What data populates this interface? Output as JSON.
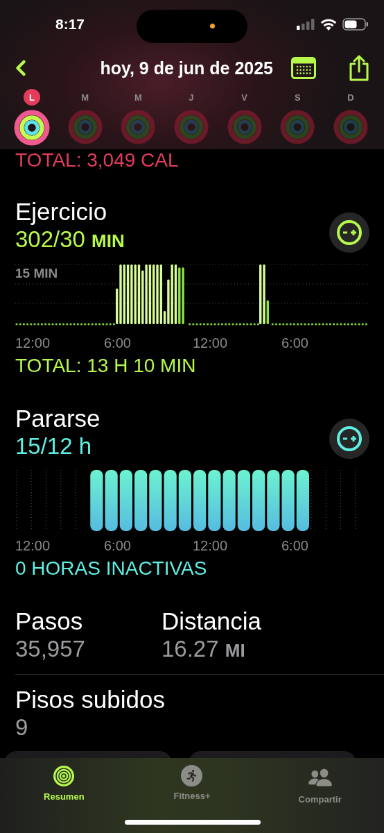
{
  "status_bar": {
    "time": "8:17"
  },
  "nav": {
    "title": "hoy, 9 de jun de 2025"
  },
  "week": [
    {
      "letter": "L",
      "selected": true
    },
    {
      "letter": "M",
      "selected": false
    },
    {
      "letter": "M",
      "selected": false
    },
    {
      "letter": "J",
      "selected": false
    },
    {
      "letter": "V",
      "selected": false
    },
    {
      "letter": "S",
      "selected": false
    },
    {
      "letter": "D",
      "selected": false
    }
  ],
  "move": {
    "total": "TOTAL: 3,049 CAL"
  },
  "exercise": {
    "title": "Ejercicio",
    "value": "302/30",
    "unit": "MIN",
    "gridline_label": "15 MIN",
    "x_labels": [
      "12:00",
      "6:00",
      "12:00",
      "6:00"
    ],
    "total": "TOTAL: 13 H 10 MIN"
  },
  "stand": {
    "title": "Pararse",
    "value": "15/12 h",
    "x_labels": [
      "12:00",
      "6:00",
      "12:00",
      "6:00"
    ],
    "total": "0 HORAS INACTIVAS"
  },
  "stats": [
    {
      "label": "Pasos",
      "value": "35,957"
    },
    {
      "label": "Distancia",
      "value": "16.27",
      "unit": "MI"
    }
  ],
  "floors": {
    "label": "Pisos subidos",
    "value": "9"
  },
  "tabs": [
    {
      "label": "Resumen",
      "selected": true
    },
    {
      "label": "Fitness+",
      "selected": false
    },
    {
      "label": "Compartir",
      "selected": false
    }
  ]
}
